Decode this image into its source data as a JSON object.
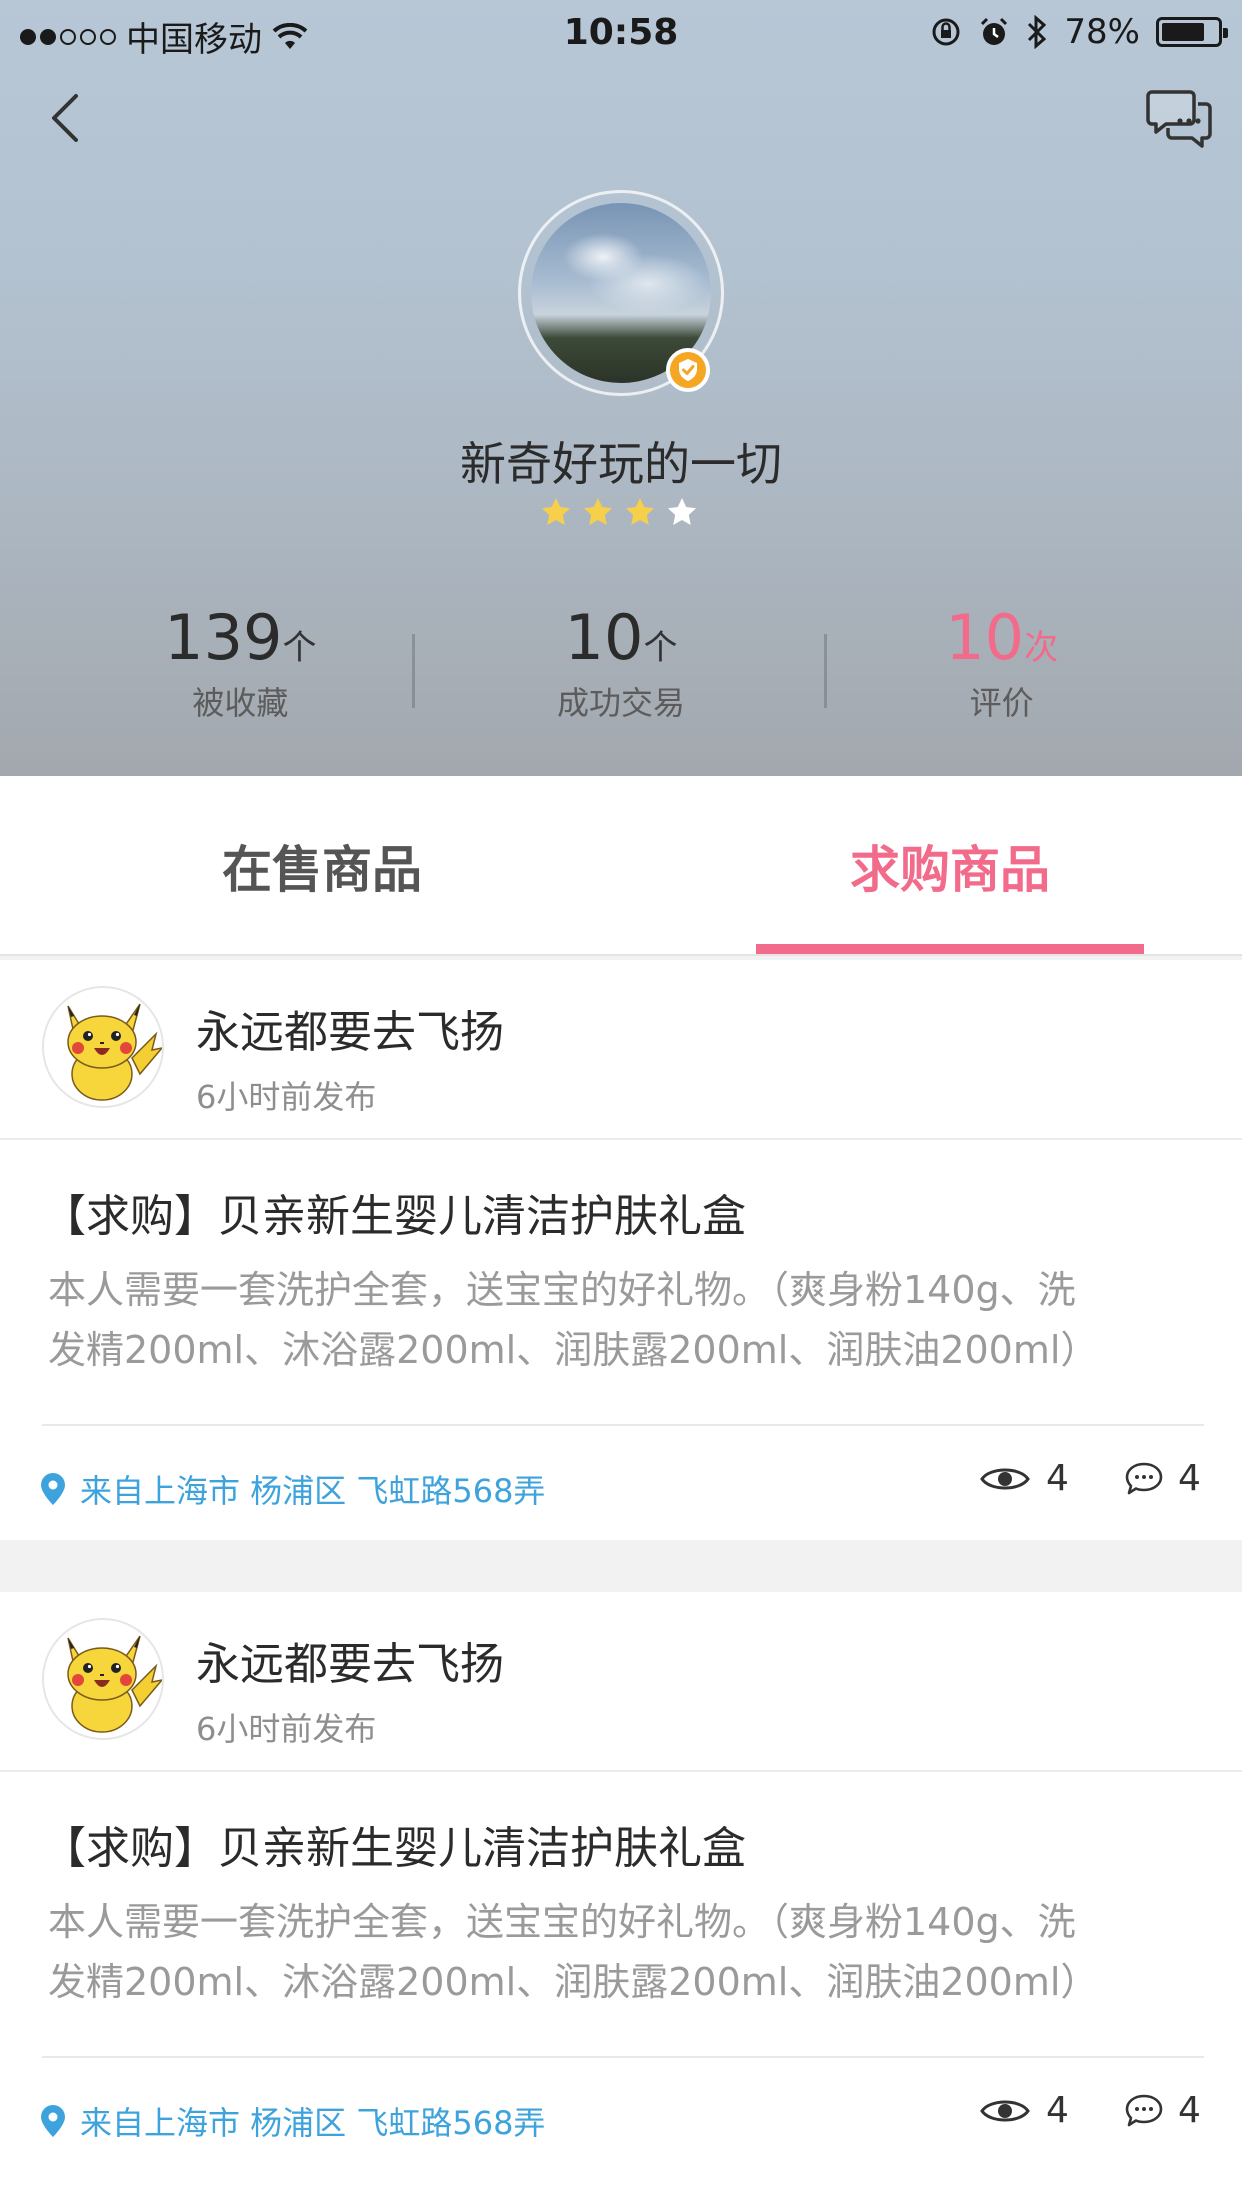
{
  "status_bar": {
    "carrier": "中国移动",
    "time": "10:58",
    "battery_percent": "78%",
    "battery_level": 0.78,
    "signal_bars_filled": 2,
    "signal_bars_total": 5
  },
  "header": {
    "back_icon": "chevron-left-icon",
    "chat_icon": "chat-bubbles-icon",
    "username": "新奇好玩的一切",
    "rating_stars_filled": 3,
    "rating_stars_total": 4,
    "verified_icon": "verified-shield-icon",
    "colors": {
      "star_filled": "#f7d04b",
      "star_empty": "#ffffff",
      "badge": "#f5a623"
    }
  },
  "stats": [
    {
      "value": "139",
      "unit": "个",
      "label": "被收藏"
    },
    {
      "value": "10",
      "unit": "个",
      "label": "成功交易"
    },
    {
      "value": "10",
      "unit": "次",
      "label": "评价"
    }
  ],
  "tabs": {
    "on_sale": "在售商品",
    "wanted": "求购商品",
    "active": "wanted",
    "accent_color": "#f26b8a"
  },
  "posts": [
    {
      "author": "永远都要去飞扬",
      "time": "6小时前发布",
      "title": "【求购】贝亲新生婴儿清洁护肤礼盒",
      "description_line1": "本人需要一套洗护全套，送宝宝的好礼物。（爽身粉140g、洗",
      "description_line2": "发精200ml、沐浴露200ml、润肤露200ml、润肤油200ml）",
      "location": "来自上海市 杨浦区 飞虹路568弄",
      "views": "4",
      "comments": "4"
    },
    {
      "author": "永远都要去飞扬",
      "time": "6小时前发布",
      "title": "【求购】贝亲新生婴儿清洁护肤礼盒",
      "description_line1": "本人需要一套洗护全套，送宝宝的好礼物。（爽身粉140g、洗",
      "description_line2": "发精200ml、沐浴露200ml、润肤露200ml、润肤油200ml）",
      "location": "来自上海市 杨浦区 飞虹路568弄",
      "views": "4",
      "comments": "4"
    }
  ]
}
